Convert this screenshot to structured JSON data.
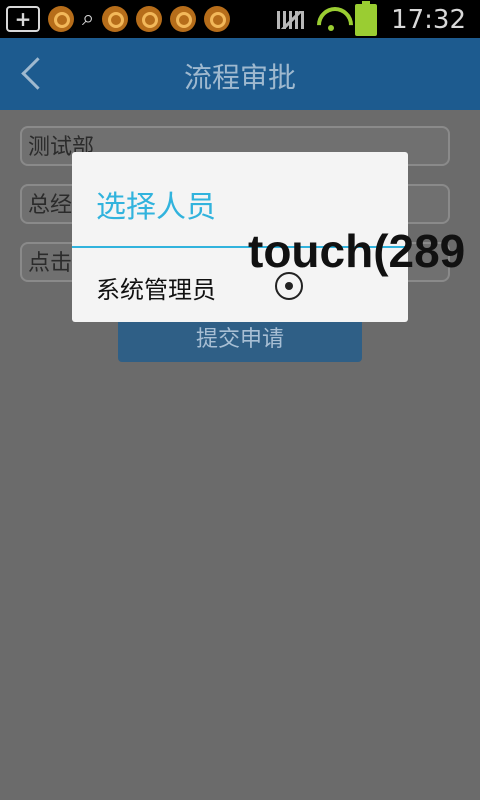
{
  "status_bar": {
    "time": "17:32",
    "icons": [
      "plus-box-icon",
      "uc-browser-icon",
      "search-icon",
      "uc-browser-icon",
      "uc-browser-icon",
      "uc-browser-icon",
      "uc-browser-icon",
      "signal-muted-icon",
      "wifi-icon",
      "battery-icon"
    ]
  },
  "header": {
    "title": "流程审批",
    "back_icon": "back-chevron-icon"
  },
  "form": {
    "department_value": "测试部",
    "position_value": "总经",
    "select_placeholder": "点击",
    "submit_label": "提交申请"
  },
  "dialog": {
    "title": "选择人员",
    "options": [
      "系统管理员"
    ]
  },
  "overlay": {
    "touch_text": "touch(289"
  },
  "colors": {
    "titlebar": "#1d5b8f",
    "dialog_accent": "#31b3dd",
    "status_bar": "#000000",
    "dim_background": "#6b6b6b"
  }
}
